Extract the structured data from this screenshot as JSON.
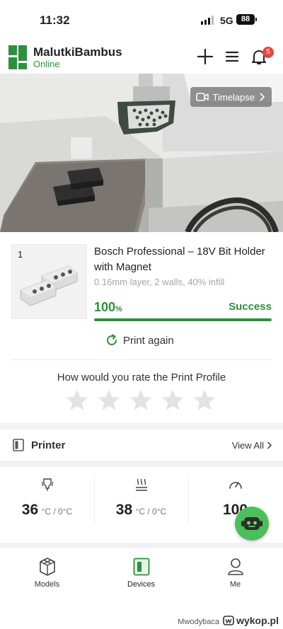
{
  "status_bar": {
    "time": "11:32",
    "network": "5G",
    "battery": "88"
  },
  "header": {
    "printer_name": "MalutkiBambus",
    "printer_status": "Online",
    "notifications_count": "5",
    "icons": [
      "plus-icon",
      "menu-icon",
      "bell-icon"
    ]
  },
  "camera": {
    "timelapse_label": "Timelapse"
  },
  "job": {
    "plate_index": "1",
    "title": "Bosch Professional – 18V Bit Holder with Magnet",
    "meta": "0.16mm layer, 2 walls, 40% infill",
    "progress_value": "100",
    "progress_unit": "%",
    "progress_fraction": 1.0,
    "state": "Success",
    "print_again_label": "Print again"
  },
  "rating": {
    "prompt": "How would you rate the Print Profile",
    "stars_filled": 0,
    "stars_total": 5
  },
  "printer_section": {
    "title": "Printer",
    "view_all_label": "View All"
  },
  "stats": [
    {
      "icon": "nozzle-temperature-icon",
      "value": "36",
      "unit": "°C / 0°C"
    },
    {
      "icon": "bed-temperature-icon",
      "value": "38",
      "unit": "°C / 0°C"
    },
    {
      "icon": "speed-icon",
      "value": "100",
      "unit": ""
    }
  ],
  "tabs": [
    {
      "label": "Models",
      "icon": "models-icon",
      "active": false
    },
    {
      "label": "Devices",
      "icon": "devices-icon",
      "active": true
    },
    {
      "label": "Me",
      "icon": "user-icon",
      "active": false
    }
  ],
  "watermark": {
    "user": "Mwodybaca",
    "site": "wykop.pl"
  },
  "colors": {
    "accent": "#2e8f3e",
    "badge": "#e8453c",
    "fab": "#4bbf5a"
  }
}
